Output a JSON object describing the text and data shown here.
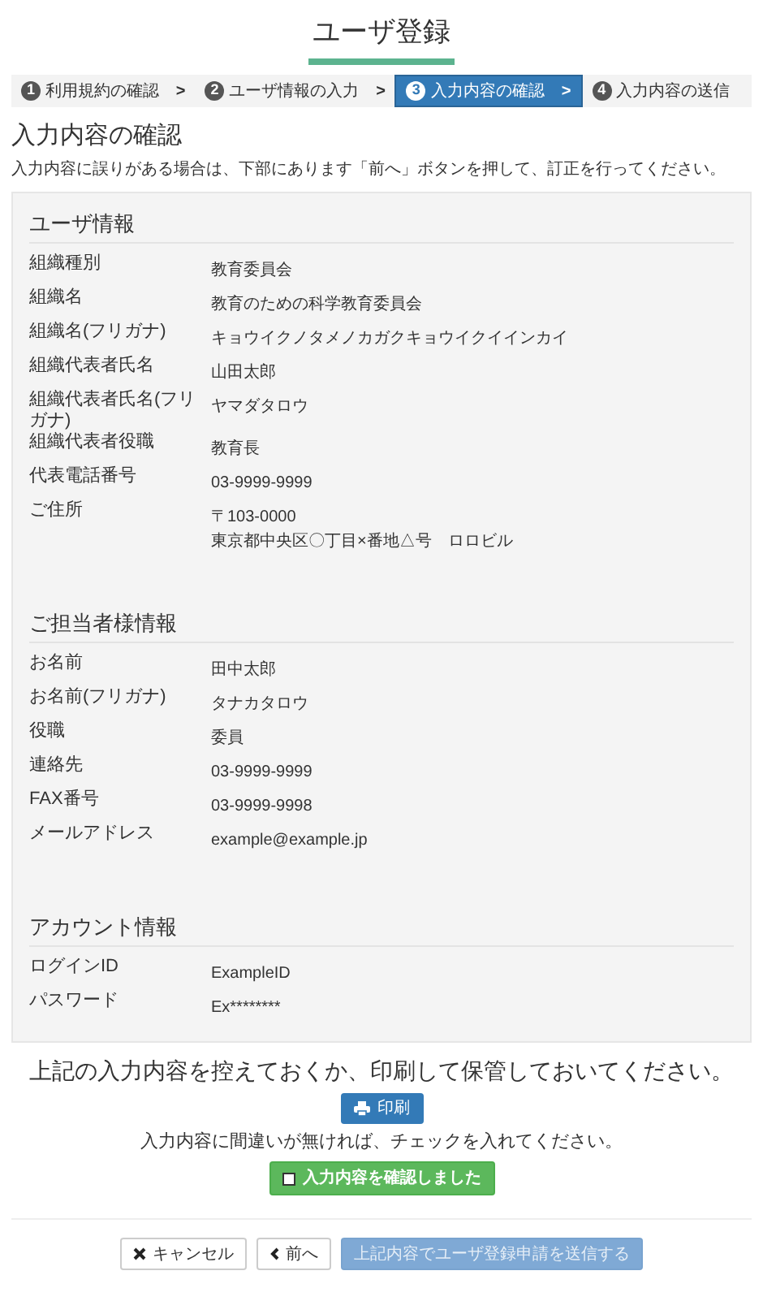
{
  "title": "ユーザ登録",
  "steps": [
    {
      "number": "1",
      "label": "利用規約の確認",
      "selected": false,
      "chevron": ">"
    },
    {
      "number": "2",
      "label": "ユーザ情報の入力",
      "selected": false,
      "chevron": ">"
    },
    {
      "number": "3",
      "label": "入力内容の確認",
      "selected": true,
      "chevron": ">"
    },
    {
      "number": "4",
      "label": "入力内容の送信",
      "selected": false
    }
  ],
  "heading": "入力内容の確認",
  "intro": "入力内容に誤りがある場合は、下部にあります「前へ」ボタンを押して、訂正を行ってください。",
  "sections": [
    {
      "title": "ユーザ情報",
      "rows": [
        {
          "label": "組織種別",
          "values": [
            "教育委員会"
          ]
        },
        {
          "label": "組織名",
          "values": [
            "教育のための科学教育委員会"
          ]
        },
        {
          "label": "組織名(フリガナ)",
          "values": [
            "キョウイクノタメノカガクキョウイクイインカイ"
          ]
        },
        {
          "label": "組織代表者氏名",
          "values": [
            "山田太郎"
          ]
        },
        {
          "label": "組織代表者氏名(フリガナ)",
          "values": [
            "ヤマダタロウ"
          ]
        },
        {
          "label": "組織代表者役職",
          "values": [
            "教育長"
          ]
        },
        {
          "label": "代表電話番号",
          "values": [
            "03-9999-9999"
          ]
        },
        {
          "label": "ご住所",
          "values": [
            "〒103-0000",
            "東京都中央区〇丁目×番地△号　ロロビル"
          ]
        }
      ]
    },
    {
      "title": "ご担当者様情報",
      "rows": [
        {
          "label": "お名前",
          "values": [
            "田中太郎"
          ]
        },
        {
          "label": "お名前(フリガナ)",
          "values": [
            "タナカタロウ"
          ]
        },
        {
          "label": "役職",
          "values": [
            "委員"
          ]
        },
        {
          "label": "連絡先",
          "values": [
            "03-9999-9999"
          ]
        },
        {
          "label": "FAX番号",
          "values": [
            "03-9999-9998"
          ]
        },
        {
          "label": "メールアドレス",
          "values": [
            "example@example.jp"
          ]
        }
      ]
    },
    {
      "title": "アカウント情報",
      "rows": [
        {
          "label": "ログインID",
          "values": [
            "ExampleID"
          ]
        },
        {
          "label": "パスワード",
          "values": [
            "Ex********"
          ]
        }
      ]
    }
  ],
  "save_note": "上記の入力内容を控えておくか、印刷して保管しておいてください。",
  "print_button": "印刷",
  "check_note": "入力内容に間違いが無ければ、チェックを入れてください。",
  "confirm": {
    "label": "入力内容を確認しました",
    "checked": false
  },
  "buttons": [
    {
      "kind": "cancel",
      "label": "キャンセル",
      "disabled": false
    },
    {
      "kind": "back",
      "label": "前へ",
      "disabled": false
    },
    {
      "kind": "submit",
      "label": "上記内容でユーザ登録申請を送信する",
      "disabled": true
    }
  ]
}
